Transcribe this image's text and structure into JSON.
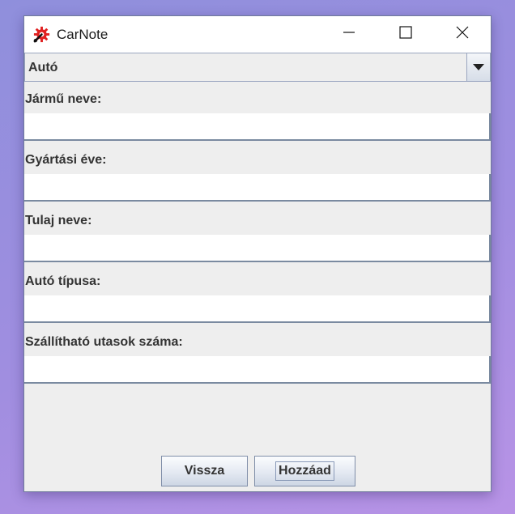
{
  "window": {
    "title": "CarNote",
    "icons": {
      "app": "gear-wrench-icon",
      "minimize": "minimize-icon",
      "maximize": "maximize-icon",
      "close": "close-icon"
    }
  },
  "vehicle_type_select": {
    "selected": "Autó",
    "arrow_icon": "chevron-down-icon"
  },
  "form": {
    "fields": [
      {
        "label": "Jármű neve:",
        "value": ""
      },
      {
        "label": "Gyártási éve:",
        "value": ""
      },
      {
        "label": "Tulaj neve:",
        "value": ""
      },
      {
        "label": "Autó típusa:",
        "value": ""
      },
      {
        "label": "Szállítható utasok száma:",
        "value": ""
      }
    ]
  },
  "buttons": {
    "back_label": "Vissza",
    "add_label": "Hozzáad"
  },
  "colors": {
    "app_icon_red": "#e02020",
    "panel_background": "#eeeeee"
  }
}
